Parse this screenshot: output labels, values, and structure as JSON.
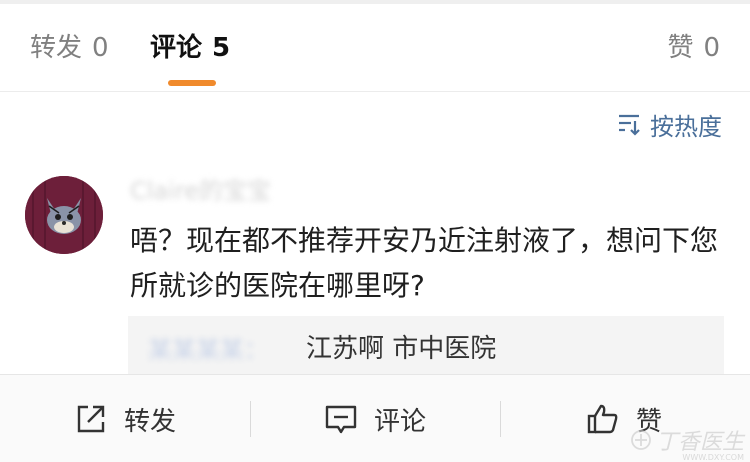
{
  "tabs": {
    "repost": {
      "label": "转发",
      "count": "0"
    },
    "comment": {
      "label": "评论",
      "count": "5"
    },
    "like": {
      "label": "赞",
      "count": "0"
    }
  },
  "sort": {
    "label": "按热度",
    "icon": "sort-icon"
  },
  "comment": {
    "username": "Claire的宝宝",
    "avatar": "cat-avatar",
    "text": "唔？现在都不推荐开安乃近注射液了，想问下您所就诊的医院在哪里呀?",
    "reply": {
      "username": "某某某某：",
      "text": "江苏啊  市中医院"
    }
  },
  "actions": {
    "repost": {
      "label": "转发",
      "icon": "share-icon"
    },
    "comment": {
      "label": "评论",
      "icon": "comment-icon"
    },
    "like": {
      "label": "赞",
      "icon": "thumbs-up-icon"
    }
  },
  "watermark": {
    "text": "丁香医生",
    "sub": "WWW.DXY.COM"
  },
  "colors": {
    "accent": "#f08a2c",
    "link": "#4a6f9a"
  }
}
